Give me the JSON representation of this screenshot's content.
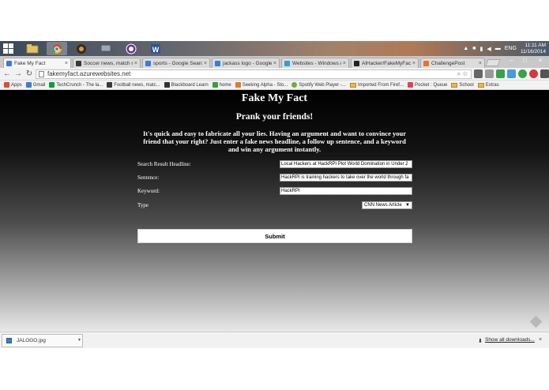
{
  "taskbar": {
    "apps": [
      {
        "name": "file-explorer-icon",
        "color": "#e3c36a"
      },
      {
        "name": "chrome-icon",
        "color": "#4aa54a"
      },
      {
        "name": "mascot-icon",
        "color": "#8a6a3a"
      },
      {
        "name": "network-icon",
        "color": "#9aa8b8"
      },
      {
        "name": "purple-app-icon",
        "color": "#6a2fa0"
      },
      {
        "name": "word-icon",
        "color": "#2b5797"
      }
    ],
    "language": "ENG",
    "time": "11:11 AM",
    "date": "11/16/2014"
  },
  "tabs": [
    {
      "label": "Fake My Fact",
      "favicon": "#3b7cd6",
      "active": true
    },
    {
      "label": "Soccer news, match r",
      "favicon": "#3a3a3a",
      "active": false
    },
    {
      "label": "sports - Google Searc",
      "favicon": "#3b7cd6",
      "active": false
    },
    {
      "label": "jackass logo - Google",
      "favicon": "#3b7cd6",
      "active": false
    },
    {
      "label": "Websites - Windows A",
      "favicon": "#2fa0d8",
      "active": false
    },
    {
      "label": "AlHacker/FakeMyFact",
      "favicon": "#222222",
      "active": false
    },
    {
      "label": "ChallengePost",
      "favicon": "#e0762a",
      "active": false
    }
  ],
  "address": {
    "url": "fakemyfact.azurewebsites.net"
  },
  "bookmarks": [
    {
      "label": "Apps",
      "kind": "apps",
      "color": "#e04a3a"
    },
    {
      "label": "Gmail",
      "kind": "site",
      "color": "#3b7cd6"
    },
    {
      "label": "TechCrunch - The la...",
      "kind": "site",
      "color": "#0a9e3a"
    },
    {
      "label": "Football news, matc...",
      "kind": "site",
      "color": "#3a3a3a"
    },
    {
      "label": "Blackboard Learn",
      "kind": "site",
      "color": "#333333"
    },
    {
      "label": "home",
      "kind": "site",
      "color": "#3c9e3c"
    },
    {
      "label": "Seeking Alpha - Sto...",
      "kind": "site",
      "color": "#e07a2a"
    },
    {
      "label": "Spotify Web Player -...",
      "kind": "site",
      "color": "#6ab03a"
    },
    {
      "label": "Imported From Firef...",
      "kind": "folder",
      "color": "#e8b84a"
    },
    {
      "label": "Pocket : Queue",
      "kind": "site",
      "color": "#e0435a"
    },
    {
      "label": "School",
      "kind": "folder",
      "color": "#e8b84a"
    },
    {
      "label": "Extras",
      "kind": "folder",
      "color": "#e8b84a"
    }
  ],
  "page": {
    "title": "Fake My Fact",
    "subtitle": "Prank your friends!",
    "description": "It's quick and easy to fabricate all your lies. Having an argument and want to convince your friend that your right? Just enter a fake news headline, a follow up sentence, and a keyword and win any argument instantly.",
    "fields": {
      "headline_label": "Search Result Headline:",
      "headline_value": "Local Hackers at HackRPI Plot World Domination in Under 2",
      "sentence_label": "Sentence:",
      "sentence_value": "HackRPI is training hackers to take over the world through fa",
      "keyword_label": "Keyword:",
      "keyword_value": "HackRPI",
      "type_label": "Type",
      "type_value": "CNN News Article"
    },
    "submit_label": "Submit"
  },
  "downloads": {
    "file_name": "JALOGO.jpg",
    "show_all": "Show all downloads..."
  }
}
